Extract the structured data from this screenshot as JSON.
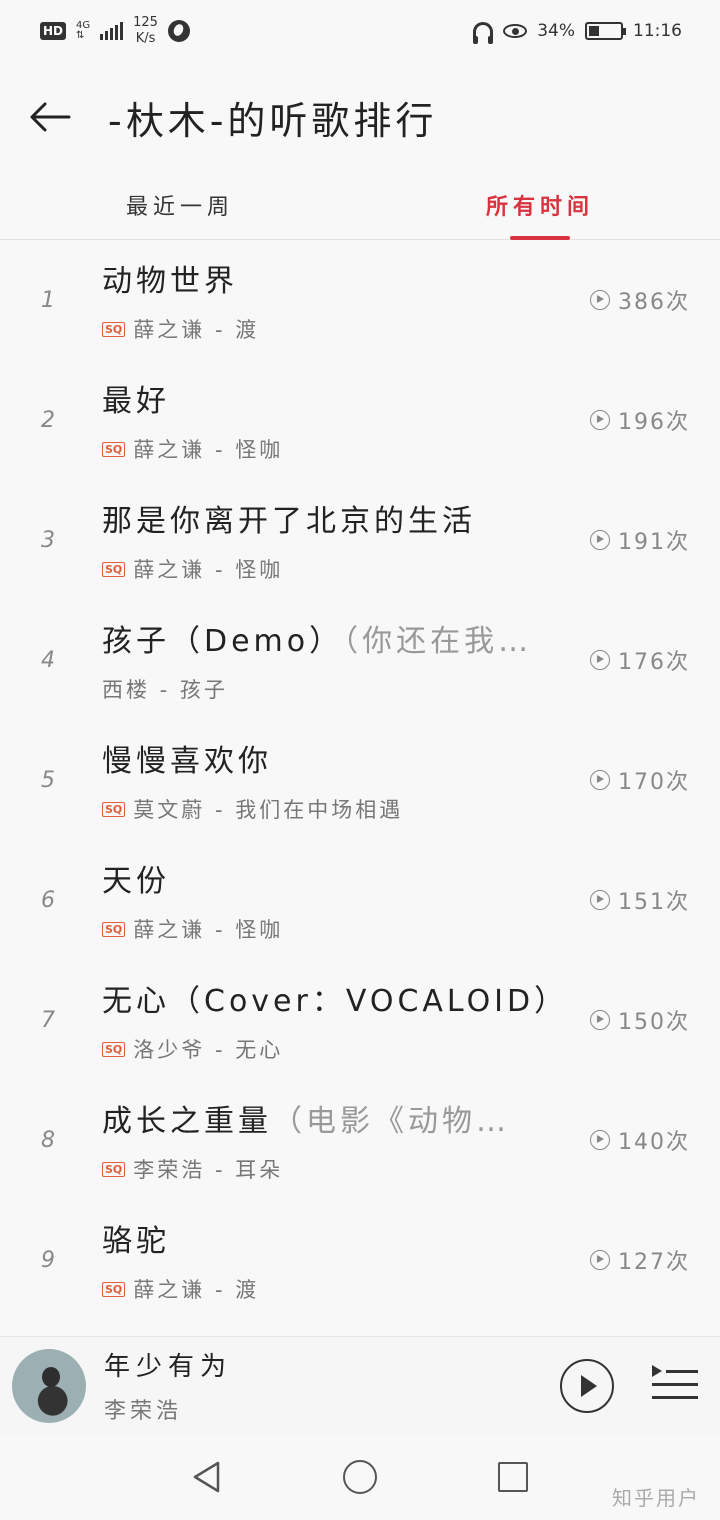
{
  "status_bar": {
    "hd": "HD",
    "network": "4G",
    "speed_value": "125",
    "speed_unit": "K/s",
    "battery": "34%",
    "battery_level": 0.34,
    "time": "11:16"
  },
  "header": {
    "title": "-杕木-的听歌排行"
  },
  "tabs": [
    {
      "label": "最近一周",
      "active": false
    },
    {
      "label": "所有时间",
      "active": true
    }
  ],
  "songs": [
    {
      "rank": "1",
      "title": "动物世界",
      "title_extra": "",
      "sq": true,
      "subtitle": "薛之谦 - 渡",
      "count": "386次"
    },
    {
      "rank": "2",
      "title": "最好",
      "title_extra": "",
      "sq": true,
      "subtitle": "薛之谦 - 怪咖",
      "count": "196次"
    },
    {
      "rank": "3",
      "title": "那是你离开了北京的生活",
      "title_extra": "",
      "sq": true,
      "subtitle": "薛之谦 - 怪咖",
      "count": "191次"
    },
    {
      "rank": "4",
      "title": "孩子（Demo）",
      "title_extra": "（你还在我…",
      "sq": false,
      "subtitle": "西楼 - 孩子",
      "count": "176次"
    },
    {
      "rank": "5",
      "title": "慢慢喜欢你",
      "title_extra": "",
      "sq": true,
      "subtitle": "莫文蔚 - 我们在中场相遇",
      "count": "170次"
    },
    {
      "rank": "6",
      "title": "天份",
      "title_extra": "",
      "sq": true,
      "subtitle": "薛之谦 - 怪咖",
      "count": "151次"
    },
    {
      "rank": "7",
      "title": "无心（Cover：VOCALOID）",
      "title_extra": "",
      "sq": true,
      "subtitle": "洛少爷 - 无心",
      "count": "150次"
    },
    {
      "rank": "8",
      "title": "成长之重量",
      "title_extra": "（电影《动物…",
      "sq": true,
      "subtitle": "李荣浩 - 耳朵",
      "count": "140次"
    },
    {
      "rank": "9",
      "title": "骆驼",
      "title_extra": "",
      "sq": true,
      "subtitle": "薛之谦 - 渡",
      "count": "127次"
    }
  ],
  "sq_label": "SQ",
  "player": {
    "title": "年少有为",
    "artist": "李荣浩"
  },
  "watermark": "知乎用户",
  "colors": {
    "accent": "#d8333e",
    "sq_badge": "#e0603a"
  }
}
